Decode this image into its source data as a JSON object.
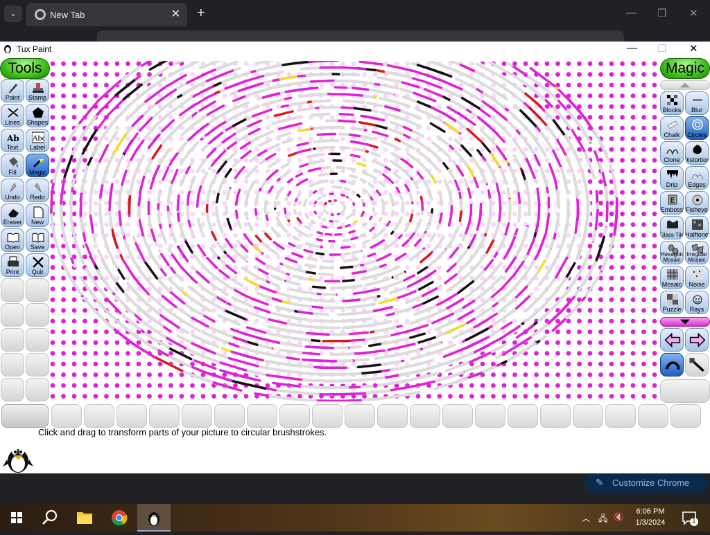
{
  "browser": {
    "tab_title": "New Tab",
    "new_tab": "+",
    "tab_close": "✕",
    "dropdown": "⌄",
    "minimize": "—",
    "restore": "❐",
    "close": "✕"
  },
  "app": {
    "title": "Tux Paint",
    "minimize": "—",
    "maximize": "☐",
    "close": "✕",
    "tools_header": "Tools",
    "magic_header": "Magic",
    "tools": [
      {
        "label": "Paint",
        "icon": "paint-brush-icon"
      },
      {
        "label": "Stamp",
        "icon": "stamp-icon"
      },
      {
        "label": "Lines",
        "icon": "lines-icon"
      },
      {
        "label": "Shapes",
        "icon": "shapes-icon"
      },
      {
        "label": "Text",
        "icon": "text-abc-icon"
      },
      {
        "label": "Label",
        "icon": "label-abc-icon"
      },
      {
        "label": "Fill",
        "icon": "fill-bucket-icon"
      },
      {
        "label": "Magic",
        "icon": "magic-wand-icon"
      },
      {
        "label": "Undo",
        "icon": "undo-icon"
      },
      {
        "label": "Redo",
        "icon": "redo-icon"
      },
      {
        "label": "Eraser",
        "icon": "eraser-icon"
      },
      {
        "label": "New",
        "icon": "new-page-icon"
      },
      {
        "label": "Open",
        "icon": "open-book-icon"
      },
      {
        "label": "Save",
        "icon": "save-book-icon"
      },
      {
        "label": "Print",
        "icon": "printer-icon"
      },
      {
        "label": "Quit",
        "icon": "quit-x-icon"
      }
    ],
    "selected_tool": "Magic",
    "magic_tools": [
      {
        "label": "Blocks",
        "icon": "blocks-icon"
      },
      {
        "label": "Blur",
        "icon": "blur-icon"
      },
      {
        "label": "Chalk",
        "icon": "chalk-icon"
      },
      {
        "label": "Circles",
        "icon": "circles-icon"
      },
      {
        "label": "Clone",
        "icon": "clone-icon"
      },
      {
        "label": "Distortion",
        "icon": "distortion-icon"
      },
      {
        "label": "Drip",
        "icon": "drip-icon"
      },
      {
        "label": "Edges",
        "icon": "edges-icon"
      },
      {
        "label": "Emboss",
        "icon": "emboss-icon"
      },
      {
        "label": "Fisheye",
        "icon": "fisheye-icon"
      },
      {
        "label": "Glass Tile",
        "icon": "glass-tile-icon"
      },
      {
        "label": "Halftone",
        "icon": "halftone-icon"
      },
      {
        "label": "Hexagon Mosaic",
        "icon": "hexagon-mosaic-icon"
      },
      {
        "label": "Irregular Mosaic",
        "icon": "irregular-mosaic-icon"
      },
      {
        "label": "Mosaic",
        "icon": "mosaic-icon"
      },
      {
        "label": "Noise",
        "icon": "noise-icon"
      },
      {
        "label": "Puzzle",
        "icon": "puzzle-icon"
      },
      {
        "label": "Rays",
        "icon": "rays-icon"
      }
    ],
    "selected_magic": "Circles",
    "colors": {
      "tools_header": "#3bbf18",
      "button": "#a9c3e6",
      "button_selected": "#1f5fbf",
      "scroll_up": "#c0c0c0",
      "scroll_down": "#e02ad8",
      "canvas_dots": "#e020d8"
    },
    "status_text": "Click and drag to transform parts of your picture to circular brushstrokes."
  },
  "chrome_footer": {
    "customize_label": "Customize Chrome",
    "customize_icon": "pencil-icon"
  },
  "taskbar": {
    "apps": [
      "start-icon",
      "search-icon",
      "file-explorer-icon",
      "chrome-icon",
      "tux-paint-icon"
    ],
    "time": "6:06 PM",
    "date": "1/3/2024",
    "notifications": "1"
  }
}
